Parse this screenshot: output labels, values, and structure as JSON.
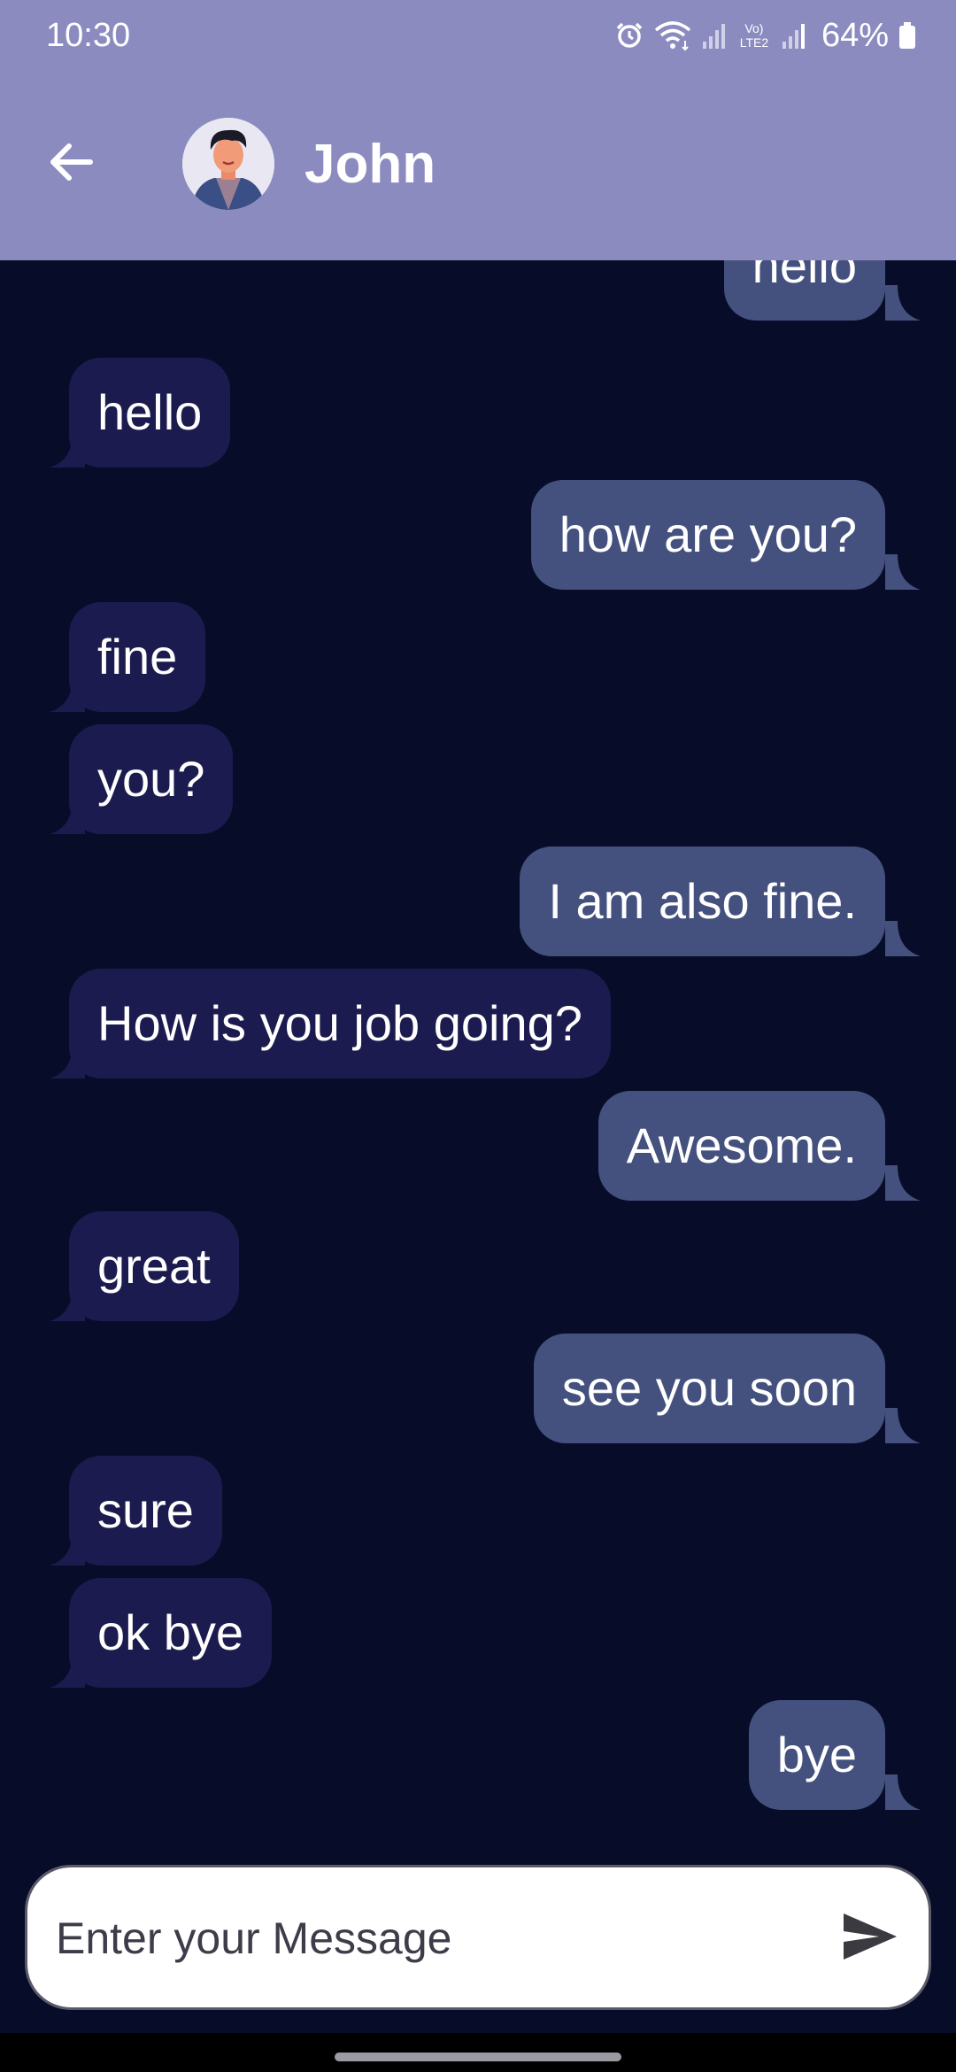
{
  "status_bar": {
    "time": "10:30",
    "battery": "64%",
    "network_label": "Vo) LTE2"
  },
  "header": {
    "contact_name": "John",
    "background": "#8b8bc0"
  },
  "messages": [
    {
      "text": "hello",
      "direction": "outgoing"
    },
    {
      "text": "hello",
      "direction": "incoming"
    },
    {
      "text": "how are you?",
      "direction": "outgoing"
    },
    {
      "text": "fine",
      "direction": "incoming"
    },
    {
      "text": "you?",
      "direction": "incoming"
    },
    {
      "text": "I am also fine.",
      "direction": "outgoing"
    },
    {
      "text": "How is you job going?",
      "direction": "incoming"
    },
    {
      "text": "Awesome.",
      "direction": "outgoing"
    },
    {
      "text": "great",
      "direction": "incoming"
    },
    {
      "text": "see you soon",
      "direction": "outgoing"
    },
    {
      "text": "sure",
      "direction": "incoming"
    },
    {
      "text": "ok bye",
      "direction": "incoming"
    },
    {
      "text": "bye",
      "direction": "outgoing"
    }
  ],
  "composer": {
    "placeholder": "Enter your Message",
    "value": ""
  },
  "colors": {
    "chat_background": "#070d28",
    "incoming_bubble": "#1c1b4f",
    "outgoing_bubble": "#44507e"
  },
  "icons": {
    "back": "arrow-left-icon",
    "send": "send-icon",
    "alarm": "alarm-icon",
    "wifi": "wifi-icon",
    "signal": "signal-icon",
    "battery": "battery-icon"
  }
}
